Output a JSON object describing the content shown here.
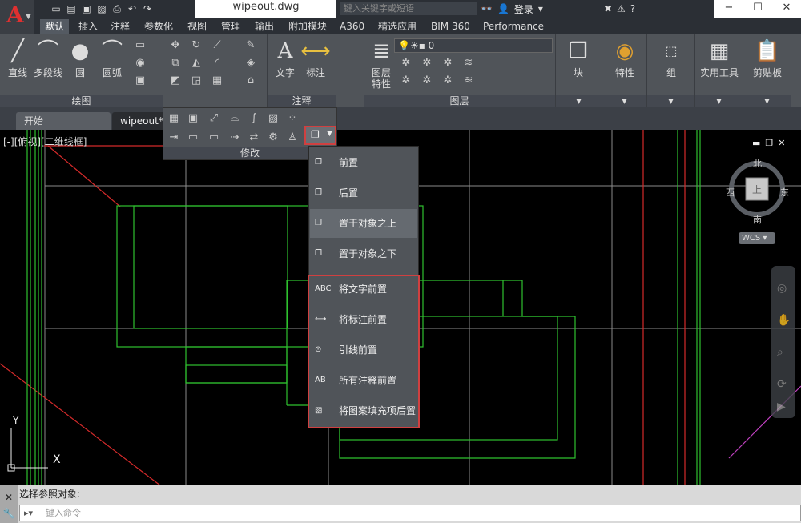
{
  "window": {
    "doc_title": "wipeout.dwg",
    "search_placeholder": "键入关键字或短语",
    "login": "登录",
    "help": "?"
  },
  "ribbon_tabs": [
    "默认",
    "插入",
    "注释",
    "参数化",
    "视图",
    "管理",
    "输出",
    "附加模块",
    "A360",
    "精选应用",
    "BIM 360",
    "Performance"
  ],
  "draw_panel": {
    "title": "绘图",
    "tools": [
      "直线",
      "多段线",
      "圆",
      "圆弧"
    ]
  },
  "annot_panel": {
    "title": "注释",
    "tools": [
      "文字",
      "标注"
    ]
  },
  "layer_panel": {
    "title": "图层",
    "tool": "图层\n特性",
    "current_layer": "0"
  },
  "other_panels": [
    "块",
    "特性",
    "组",
    "实用工具",
    "剪贴板"
  ],
  "modify_panel": {
    "title": "修改"
  },
  "file_tabs": [
    "开始",
    "wipeout*"
  ],
  "view_label": "[-][俯视][二维线框]",
  "draworder_menu": {
    "items": [
      "前置",
      "后置",
      "置于对象之上",
      "置于对象之下"
    ],
    "annotation_items": [
      "将文字前置",
      "将标注前置",
      "引线前置",
      "所有注释前置",
      "将图案填充项后置"
    ],
    "icon_text": {
      "text_front": "ABC",
      "all_annot": "AB"
    }
  },
  "viewcube": {
    "north": "北",
    "south": "南",
    "east": "东",
    "west": "西",
    "top": "上",
    "wcs": "WCS"
  },
  "ucs": {
    "y": "Y",
    "x": "X"
  },
  "command": {
    "history": "选择参照对象:",
    "placeholder": "键入命令"
  },
  "colors": {
    "green": "#2fc12f",
    "red": "#d42a2a",
    "gray": "#8a8a8a",
    "magenta": "#c040c0",
    "accent": "#d04040"
  }
}
